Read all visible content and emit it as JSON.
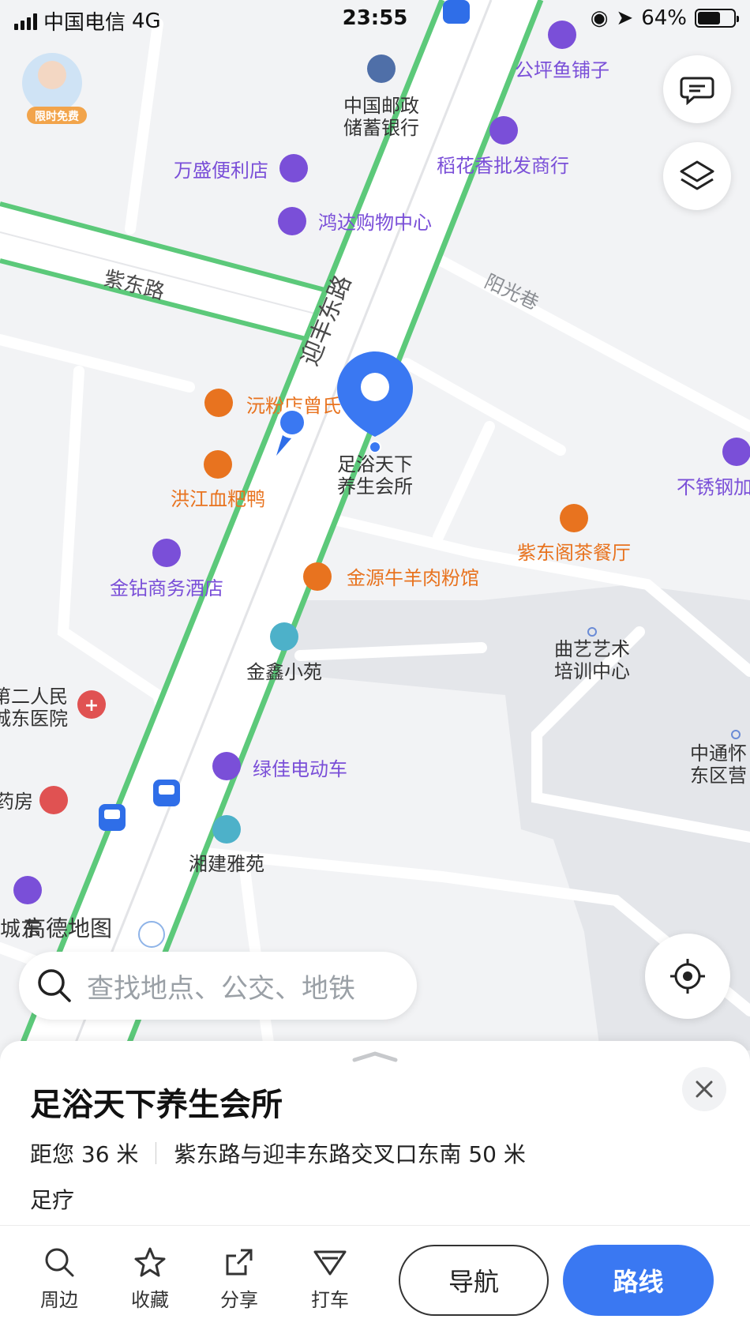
{
  "status_bar": {
    "carrier": "中国电信",
    "network": "4G",
    "time": "23:55",
    "battery": "64%",
    "battery_level": 0.64
  },
  "map": {
    "roads": {
      "main": "迎丰东路",
      "cross": "紫东路",
      "lane": "阳光巷"
    },
    "pois": [
      {
        "name": "中国邮政\n储蓄银行",
        "category": "bank",
        "color": "#4f6fa8"
      },
      {
        "name": "公坪鱼铺子",
        "category": "shopping",
        "color": "#7a4fd8"
      },
      {
        "name": "稻花香批发商行",
        "category": "shopping",
        "color": "#7a4fd8"
      },
      {
        "name": "万盛便利店",
        "category": "shopping",
        "color": "#7a4fd8"
      },
      {
        "name": "鸿达购物中心",
        "category": "shopping",
        "color": "#7a4fd8"
      },
      {
        "name": "沅粉店曾氏",
        "category": "food",
        "color": "#e8731f"
      },
      {
        "name": "洪江血粑鸭",
        "category": "food",
        "color": "#e8731f"
      },
      {
        "name": "金钻商务酒店",
        "category": "hotel",
        "color": "#7a4fd8"
      },
      {
        "name": "金源牛羊肉粉馆",
        "category": "food",
        "color": "#e8731f"
      },
      {
        "name": "紫东阁茶餐厅",
        "category": "food",
        "color": "#e8731f"
      },
      {
        "name": "不锈钢加",
        "category": "shopping",
        "color": "#7a4fd8"
      },
      {
        "name": "曲艺艺术\n培训中心",
        "category": "place",
        "color": "#333333"
      },
      {
        "name": "金鑫小苑",
        "category": "residential",
        "color": "#333333"
      },
      {
        "name": "第二人民\n城东医院",
        "category": "hospital",
        "color": "#333333"
      },
      {
        "name": "绿佳电动车",
        "category": "shop",
        "color": "#7a4fd8"
      },
      {
        "name": "药房",
        "category": "pharmacy",
        "color": "#333333"
      },
      {
        "name": "湘建雅苑",
        "category": "residential",
        "color": "#333333"
      },
      {
        "name": "中通怀\n东区营",
        "category": "place",
        "color": "#333333"
      }
    ],
    "selected_poi": "足浴天下\n养生会所",
    "promo_badge": "限时免费",
    "watermark": "高德地图",
    "watermark_prefix": "城东"
  },
  "search": {
    "placeholder": "查找地点、公交、地铁"
  },
  "place_sheet": {
    "title": "足浴天下养生会所",
    "distance": "距您 36 米",
    "address": "紫东路与迎丰东路交叉口东南 50 米",
    "category": "足疗"
  },
  "actions": [
    {
      "label": "周边",
      "icon": "search-icon"
    },
    {
      "label": "收藏",
      "icon": "star-icon"
    },
    {
      "label": "分享",
      "icon": "share-icon"
    },
    {
      "label": "打车",
      "icon": "taxi-icon"
    }
  ],
  "buttons": {
    "navigate": "导航",
    "route": "路线"
  },
  "colors": {
    "accent": "#3a78f2",
    "road_green": "#5cc97a",
    "poi_shop": "#7a4fd8",
    "poi_food": "#e8731f"
  }
}
